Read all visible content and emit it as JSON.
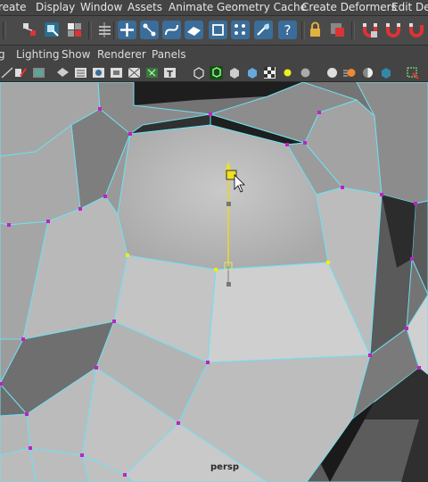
{
  "menu": {
    "items": [
      "reate",
      "Display",
      "Window",
      "Assets",
      "Animate",
      "Geometry Cache",
      "Create Deformers",
      "Edit Defo"
    ]
  },
  "panel_menu": {
    "items": [
      "g",
      "Lighting",
      "Show",
      "Renderer",
      "Panels"
    ]
  },
  "viewport": {
    "camera_label": "persp"
  },
  "colors": {
    "wire": "#6fe0f0",
    "vertex": "#c020c8",
    "selected_vertex": "#f0f000",
    "manipulator": "#f0e020"
  },
  "icons": {
    "shelf": [
      "select-hierarchy-icon",
      "lasso-select-icon",
      "paint-select-icon",
      "snap-grid-icon",
      "move-tool-icon",
      "snap-curve-icon",
      "snap-point-icon",
      "snap-view-plane-icon",
      "make-live-icon",
      "history-icon",
      "render-icon",
      "help-icon",
      "lock-icon",
      "ipr-render-icon",
      "magnet-icon",
      "soft-select-icon"
    ],
    "viewport": [
      "camera-attributes-icon",
      "bookmark-icon",
      "image-plane-icon",
      "film-gate-icon",
      "resolution-gate-icon",
      "gate-mask-icon",
      "grid-icon",
      "wireframe-icon",
      "smooth-shade-icon",
      "wireframe-on-shaded-icon",
      "xray-icon",
      "use-default-material-icon",
      "shadows-icon",
      "textured-icon",
      "isolate-select-icon"
    ]
  }
}
